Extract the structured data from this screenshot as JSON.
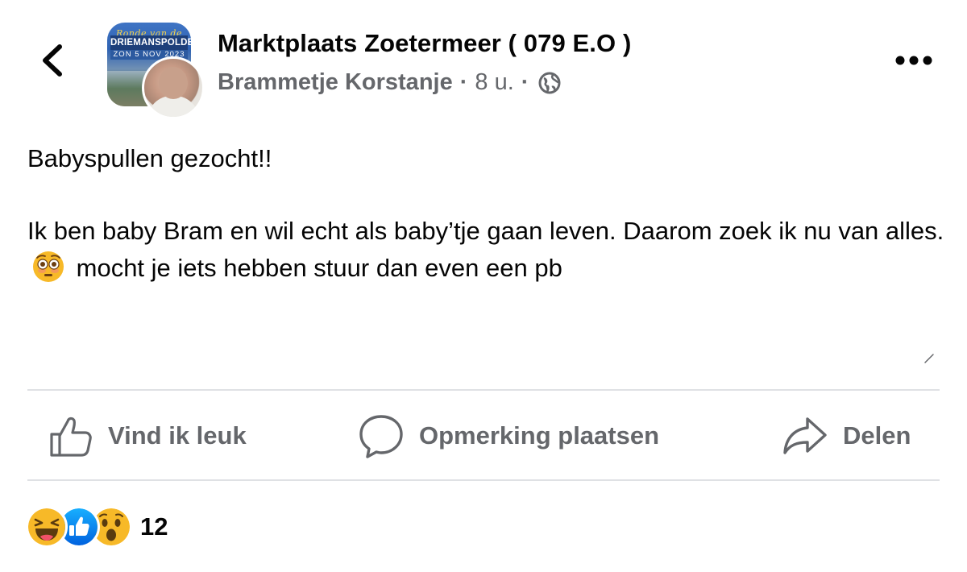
{
  "header": {
    "group_name": "Marktplaats Zoetermeer ( 079 E.O )",
    "author": "Brammetje Korstanje",
    "separator": "·",
    "time": "8 u.",
    "avatar_text": {
      "top": "Ronde van de",
      "title": "DRIEMANSPOLDER",
      "date": "ZON 5 NOV 2023"
    },
    "icons": {
      "back": "chevron-left-icon",
      "privacy": "globe-icon",
      "more": "more-horizontal-icon"
    }
  },
  "post": {
    "paragraph1": "Babyspullen gezocht!!",
    "paragraph2_part1": "Ik ben baby Bram en wil echt als baby’tje gaan leven. Daarom zoek ik nu van alles.",
    "emoji": "flushed-face",
    "paragraph2_part2": "mocht je iets hebben stuur dan even een pb"
  },
  "actions": {
    "like_label": "Vind ik leuk",
    "comment_label": "Opmerking plaatsen",
    "share_label": "Delen"
  },
  "reactions": {
    "types": [
      "haha",
      "like",
      "wow"
    ],
    "count": "12"
  },
  "colors": {
    "text_primary": "#050505",
    "text_secondary": "#65676b",
    "divider": "#dfe1e4",
    "like_blue": "#1877f2",
    "reaction_yellow": "#f7b928"
  }
}
